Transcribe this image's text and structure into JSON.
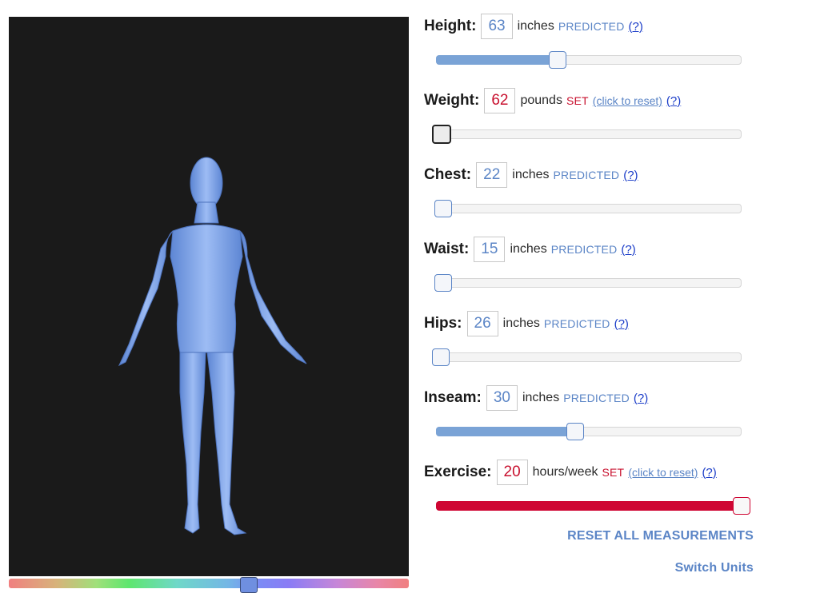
{
  "viewer": {
    "background": "#1a1a1a",
    "model_color": "#7ca2e8",
    "model_name": "body-model"
  },
  "hue_slider": {
    "level": 0.6
  },
  "measurements": [
    {
      "key": "height",
      "label": "Height:",
      "value": "63",
      "unit": "inches",
      "status": "PREDICTED",
      "state": "predicted",
      "help": "(?)",
      "slider_level": 0.41
    },
    {
      "key": "weight",
      "label": "Weight:",
      "value": "62",
      "unit": "pounds",
      "status": "SET",
      "state": "set",
      "reset": "(click to reset)",
      "help": "(?)",
      "slider_level": 0.0
    },
    {
      "key": "chest",
      "label": "Chest:",
      "value": "22",
      "unit": "inches",
      "status": "PREDICTED",
      "state": "predicted",
      "help": "(?)",
      "slider_level": 0.02
    },
    {
      "key": "waist",
      "label": "Waist:",
      "value": "15",
      "unit": "inches",
      "status": "PREDICTED",
      "state": "predicted",
      "help": "(?)",
      "slider_level": 0.02
    },
    {
      "key": "hips",
      "label": "Hips:",
      "value": "26",
      "unit": "inches",
      "status": "PREDICTED",
      "state": "predicted",
      "help": "(?)",
      "slider_level": 0.0
    },
    {
      "key": "inseam",
      "label": "Inseam:",
      "value": "30",
      "unit": "inches",
      "status": "PREDICTED",
      "state": "predicted",
      "help": "(?)",
      "slider_level": 0.47
    },
    {
      "key": "exercise",
      "label": "Exercise:",
      "value": "20",
      "unit": "hours/week",
      "status": "SET",
      "state": "set",
      "reset": "(click to reset)",
      "help": "(?)",
      "slider_level": 1.0
    }
  ],
  "actions": {
    "reset_all": "RESET ALL MEASUREMENTS",
    "switch_units": "Switch Units"
  },
  "colors": {
    "predicted": "#5b85c6",
    "set": "#c8102e",
    "slider_fill": "#7aa3d6",
    "exercise_fill": "#cf0633"
  }
}
